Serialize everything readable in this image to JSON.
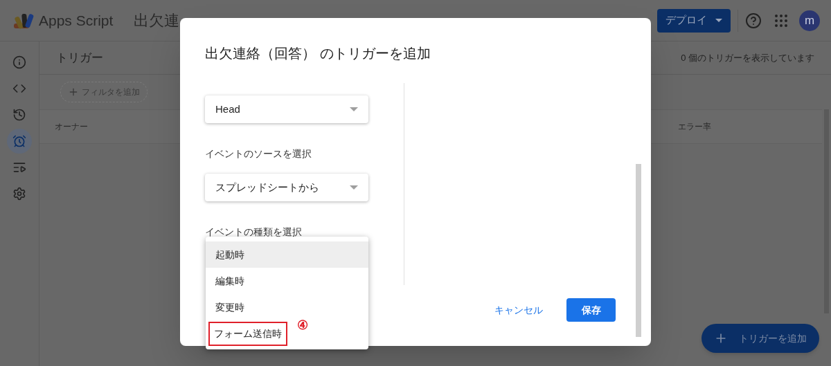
{
  "app": {
    "product": "Apps Script",
    "title": "出欠連",
    "deploy_button": "デプロイ",
    "avatar": "m"
  },
  "sidebar": {
    "items": [
      {
        "kind": "info",
        "selected": false
      },
      {
        "kind": "code",
        "selected": false
      },
      {
        "kind": "history",
        "selected": false
      },
      {
        "kind": "alarm",
        "selected": true
      },
      {
        "kind": "executions",
        "selected": false
      },
      {
        "kind": "settings",
        "selected": false
      }
    ]
  },
  "page": {
    "heading": "トリガー",
    "count": "0 個のトリガーを表示しています",
    "filter_chip": "フィルタを追加",
    "columns": [
      "オーナー",
      "エラー率"
    ],
    "fab": "トリガーを追加"
  },
  "dialog": {
    "title": "出欠連絡（回答） のトリガーを追加",
    "deployment_select": "Head",
    "source_label": "イベントのソースを選択",
    "source_select": "スプレッドシートから",
    "type_label": "イベントの種類を選択",
    "type_menu": [
      {
        "label": "起動時",
        "selected": true,
        "annotated": false
      },
      {
        "label": "編集時",
        "selected": false,
        "annotated": false
      },
      {
        "label": "変更時",
        "selected": false,
        "annotated": false
      },
      {
        "label": "フォーム送信時",
        "selected": false,
        "annotated": true
      }
    ],
    "annotation_mark": "④",
    "cancel": "キャンセル",
    "save": "保存"
  }
}
